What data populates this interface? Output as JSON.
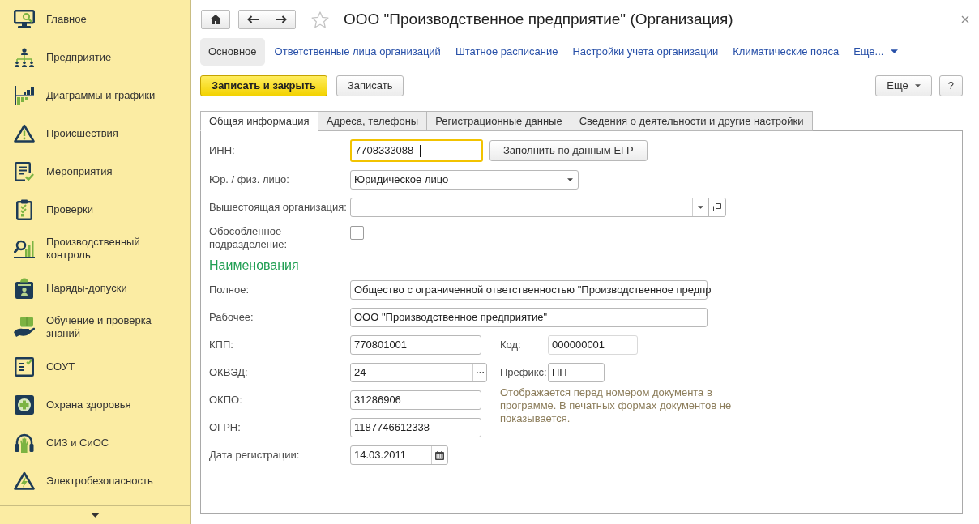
{
  "sidebar": {
    "items": [
      {
        "label": "Главное"
      },
      {
        "label": "Предприятие"
      },
      {
        "label": "Диаграммы и графики"
      },
      {
        "label": "Происшествия"
      },
      {
        "label": "Мероприятия"
      },
      {
        "label": "Проверки"
      },
      {
        "label": "Производственный контроль"
      },
      {
        "label": "Наряды-допуски"
      },
      {
        "label": "Обучение и проверка знаний"
      },
      {
        "label": "СОУТ"
      },
      {
        "label": "Охрана здоровья"
      },
      {
        "label": "СИЗ и СиОС"
      },
      {
        "label": "Электробезопасность"
      }
    ]
  },
  "header": {
    "title": "ООО \"Производственное предприятие\" (Организация)",
    "favorite": false
  },
  "nav": {
    "links": [
      {
        "label": "Основное",
        "selected": true
      },
      {
        "label": "Ответственные лица организаций",
        "selected": false
      },
      {
        "label": "Штатное расписание",
        "selected": false
      },
      {
        "label": "Настройки учета организации",
        "selected": false
      },
      {
        "label": "Климатические пояса",
        "selected": false
      }
    ],
    "more": "Еще..."
  },
  "commands": {
    "left": [
      {
        "label": "Записать и закрыть",
        "kind": "primary"
      },
      {
        "label": "Записать",
        "kind": "default"
      }
    ],
    "right": [
      {
        "label": "Еще",
        "kind": "menu"
      },
      {
        "label": "?",
        "kind": "default"
      }
    ]
  },
  "tabs": [
    {
      "label": "Общая информация",
      "selected": true
    },
    {
      "label": "Адреса, телефоны",
      "selected": false
    },
    {
      "label": "Регистрационные данные",
      "selected": false
    },
    {
      "label": "Сведения о деятельности и другие настройки",
      "selected": false
    }
  ],
  "form": {
    "fields": [
      {
        "kind": "text",
        "label": "ИНН:",
        "value": "7708333088",
        "focused": true,
        "action": "Заполнить по данным ЕГР"
      },
      {
        "kind": "select",
        "label": "Юр. / физ. лицо:",
        "value": "Юридическое лицо",
        "focused": false
      },
      {
        "kind": "reference",
        "label": "Вышестоящая организация:",
        "focused": false
      },
      {
        "kind": "checkbox",
        "label": "Обособленное подразделение:",
        "checked": false,
        "focused": false
      }
    ],
    "section_title": "Наименования",
    "names": [
      {
        "label": "Полное:",
        "value": "Общество с ограниченной ответственностью \"Производственное предпр"
      },
      {
        "label": "Рабочее:",
        "value": "ООО \"Производственное предприятие\""
      }
    ],
    "codes": [
      {
        "kind": "text",
        "label": "КПП:",
        "value": "770801001"
      },
      {
        "kind": "choice",
        "label": "ОКВЭД:",
        "value": "24"
      },
      {
        "kind": "text",
        "label": "ОКПО:",
        "value": "31286906"
      },
      {
        "kind": "text",
        "label": "ОГРН:",
        "value": "1187746612338"
      },
      {
        "kind": "date",
        "label": "Дата регистрации:",
        "value": "14.03.2011"
      }
    ],
    "extra": [
      {
        "label": "Код:",
        "value": "000000001",
        "readonly": true
      },
      {
        "label": "Префикс:",
        "value": "ПП",
        "readonly": false
      }
    ],
    "hint": "Отображается перед номером документа в программе. В печатных формах документов не показывается."
  }
}
